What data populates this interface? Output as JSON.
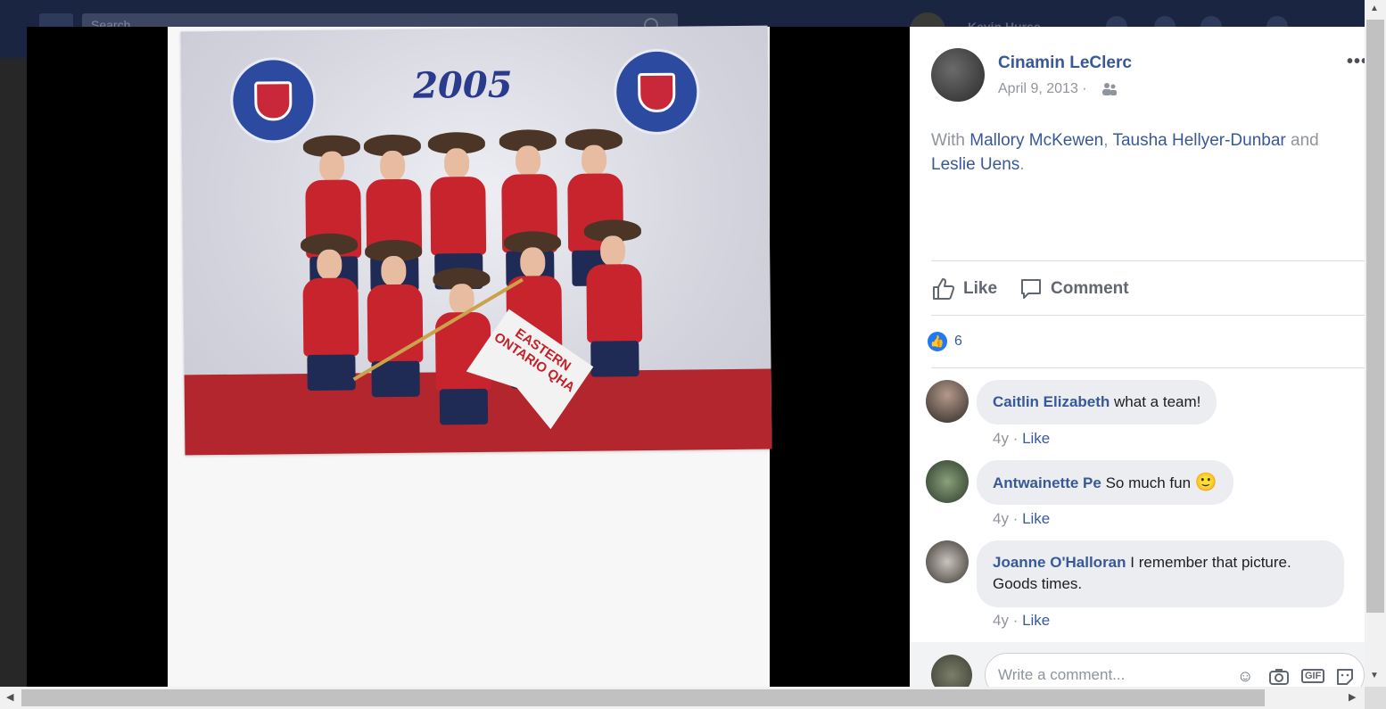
{
  "topbar": {
    "search_placeholder": "Search",
    "user_name": "Kevin Hurse"
  },
  "photo": {
    "year_text": "2005",
    "flag_text": "EASTERN ONTARIO QHA"
  },
  "post": {
    "author": "Cinamin LeClerc",
    "date": "April 9, 2013 ·",
    "with_prefix": "With",
    "tagged": [
      "Mallory McKewen",
      "Tausha Hellyer-Dunbar",
      "Leslie Uens"
    ],
    "and_word": "and",
    "more_icon": "ellipsis-icon",
    "audience_icon": "friends-icon"
  },
  "actions": {
    "like": "Like",
    "comment": "Comment"
  },
  "reactions": {
    "count": "6"
  },
  "comments": [
    {
      "name": "Caitlin Elizabeth",
      "text": "what a team!",
      "time": "4y",
      "like": "Like"
    },
    {
      "name": "Antwainette Pe",
      "text": "So much fun",
      "emoji": "🙂",
      "time": "4y",
      "like": "Like"
    },
    {
      "name": "Joanne O'Halloran",
      "text": "I remember that picture. Goods times.",
      "time": "4y",
      "like": "Like"
    }
  ],
  "composer": {
    "placeholder": "Write a comment..."
  },
  "colors": {
    "link": "#385898",
    "topbar": "#1a2542",
    "like_blue": "#2078f4"
  }
}
